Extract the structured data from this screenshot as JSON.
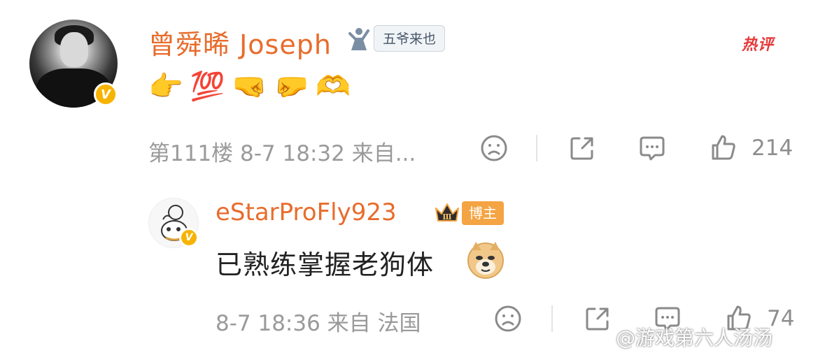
{
  "comment": {
    "username": "曾舜晞 Joseph",
    "fan_badge": "五爷来也",
    "hot_label": "热评",
    "emojis": [
      "👉",
      "💯",
      "🤜",
      "🤛",
      "🫶"
    ],
    "meta": "第111楼 8-7 18:32 来自...",
    "like_count": "214"
  },
  "reply": {
    "username": "eStarProFly923",
    "rank_badge": "Ⅲ",
    "role_badge": "博主",
    "text": "已熟练掌握老狗体",
    "meta": "8-7 18:36 来自 法国",
    "like_count": "74"
  },
  "watermark": "@游戏第六人汤汤",
  "colors": {
    "username": "#e86c2c",
    "verified_badge": "#f6b400",
    "hot": "#e5393a",
    "meta": "#9a9a9a",
    "role_badge": "#f4a443"
  },
  "icons": [
    "dislike-face-icon",
    "share-icon",
    "comment-icon",
    "like-thumb-icon",
    "verified-v-icon",
    "crown-icon",
    "doge-icon",
    "fan-badge-icon"
  ]
}
